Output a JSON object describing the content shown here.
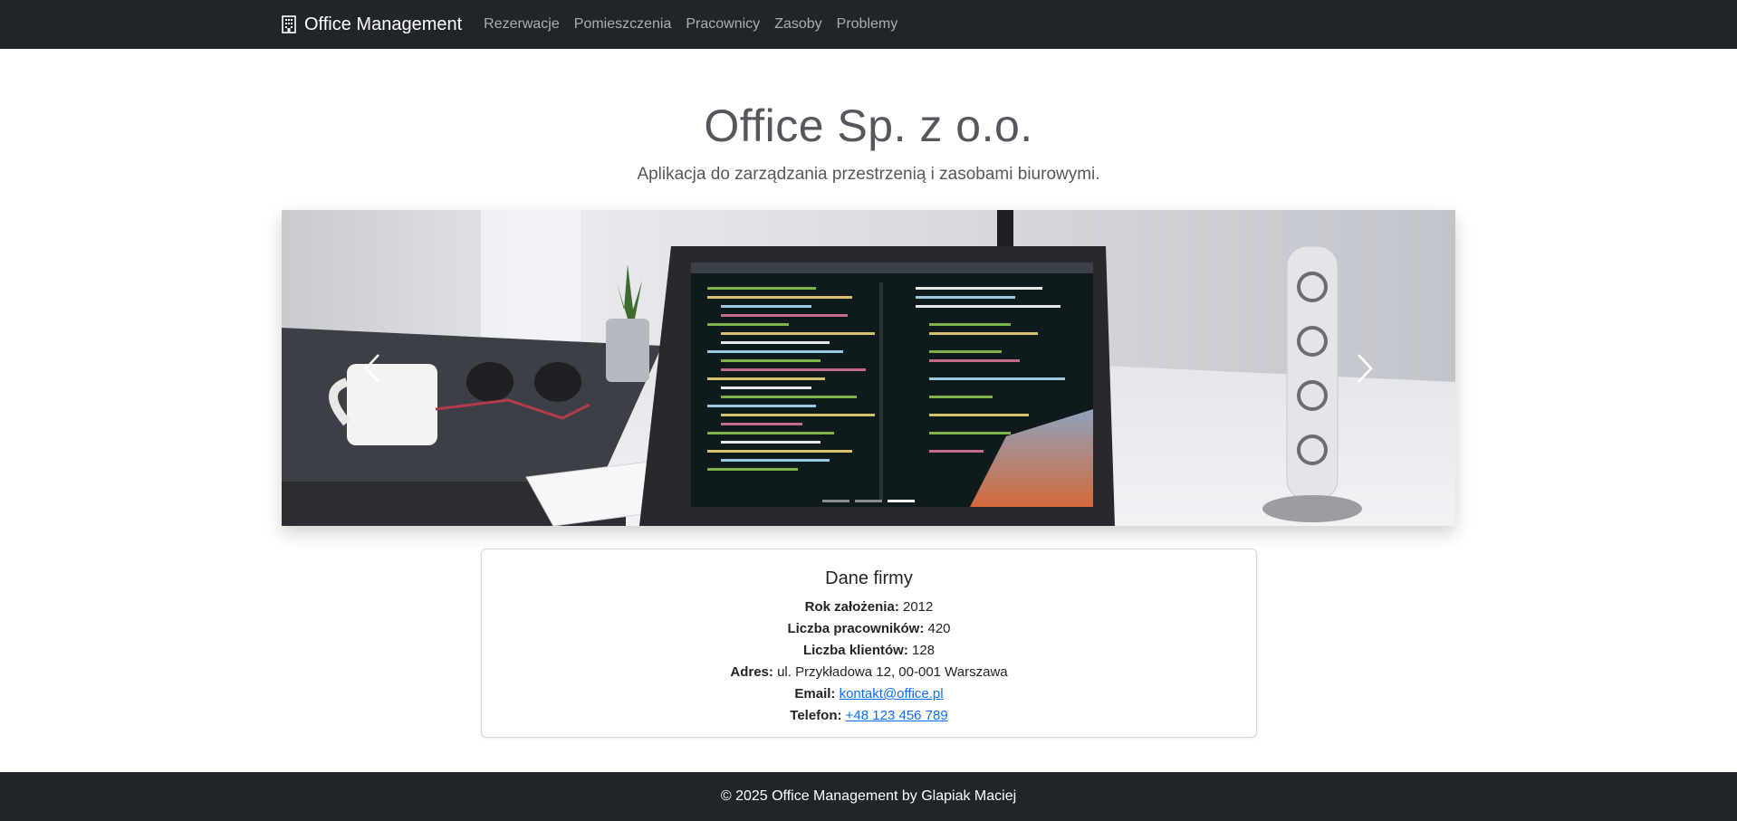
{
  "nav": {
    "brand": "Office Management",
    "brand_icon": "building-icon",
    "links": [
      "Rezerwacje",
      "Pomieszczenia",
      "Pracownicy",
      "Zasoby",
      "Problemy"
    ]
  },
  "hero": {
    "title": "Office Sp. z o.o.",
    "subtitle": "Aplikacja do zarządzania przestrzenią i zasobami biurowymi."
  },
  "carousel": {
    "slide_count": 3,
    "active_slide": 3,
    "prev_icon": "chevron-left-icon",
    "next_icon": "chevron-right-icon"
  },
  "company": {
    "title": "Dane firmy",
    "rows": [
      {
        "label": "Rok założenia:",
        "value": "2012",
        "link": false
      },
      {
        "label": "Liczba pracowników:",
        "value": "420",
        "link": false
      },
      {
        "label": "Liczba klientów:",
        "value": "128",
        "link": false
      },
      {
        "label": "Adres:",
        "value": "ul. Przykładowa 12, 00-001 Warszawa",
        "link": false
      },
      {
        "label": "Email:",
        "value": "kontakt@office.pl",
        "link": true
      },
      {
        "label": "Telefon:",
        "value": "+48 123 456 789",
        "link": true
      }
    ]
  },
  "footer": {
    "text": "© 2025 Office Management by Glapiak Maciej"
  },
  "colors": {
    "navbar_bg": "#212529",
    "link": "#0d6efd",
    "hero_text": "#54585c"
  }
}
